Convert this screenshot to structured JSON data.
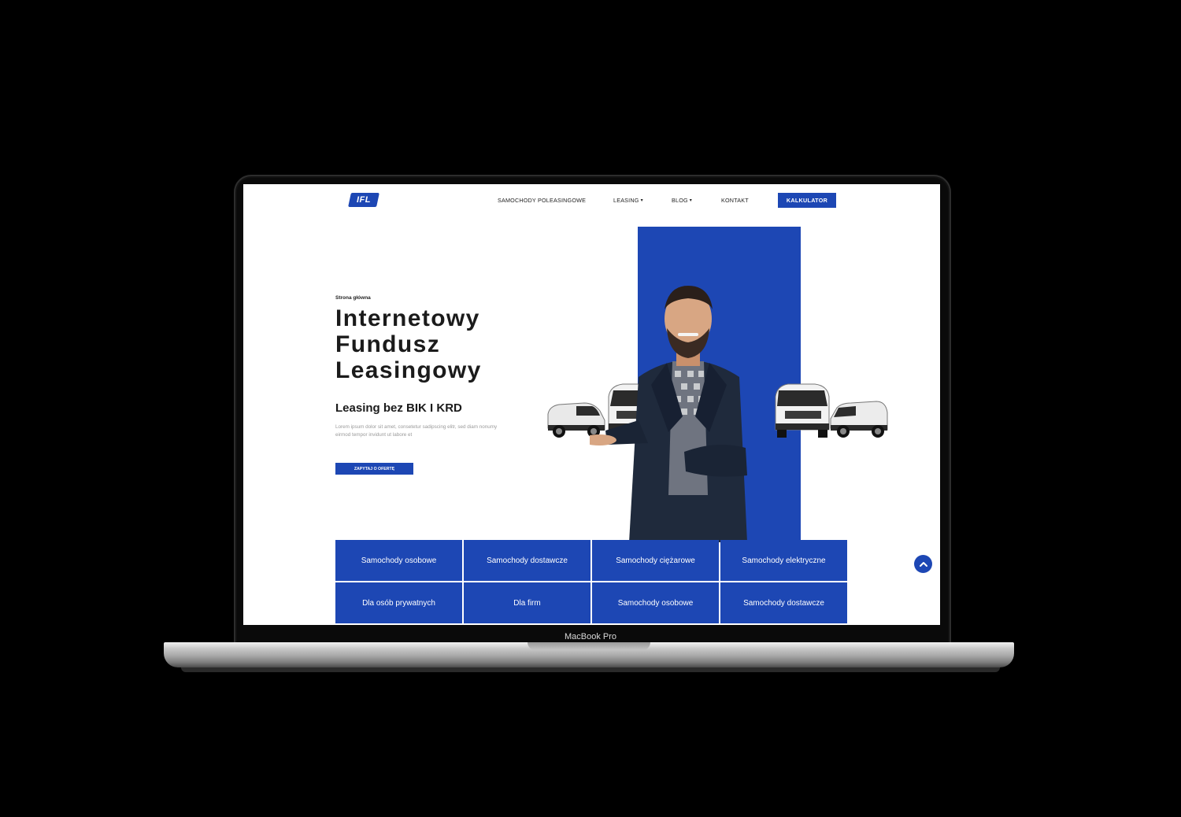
{
  "device": {
    "label": "MacBook Pro"
  },
  "site": {
    "logo_text": "IFL",
    "nav": {
      "items": [
        {
          "label": "SAMOCHODY POLEASINGOWE",
          "has_dropdown": false
        },
        {
          "label": "LEASING",
          "has_dropdown": true
        },
        {
          "label": "BLOG",
          "has_dropdown": true
        },
        {
          "label": "KONTAKT",
          "has_dropdown": false
        }
      ],
      "cta_label": "KALKULATOR"
    },
    "hero": {
      "breadcrumb": "Strona główna",
      "title": "Internetowy\nFundusz\nLeasingowy",
      "subtitle": "Leasing bez BIK I KRD",
      "text": "Lorem ipsum dolor sit amet, consetetur sadipscing elitr, sed diam nonumy eirmod tempor invidunt ut labore et",
      "button_label": "ZAPYTAJ O OFERTĘ"
    },
    "tiles": [
      "Samochody osobowe",
      "Samochody dostawcze",
      "Samochody ciężarowe",
      "Samochody elektryczne",
      "Dla osób prywatnych",
      "Dla firm",
      "Samochody osobowe",
      "Samochody dostawcze"
    ],
    "colors": {
      "brand_blue": "#1d47b4",
      "text_dark": "#1b1b1b",
      "muted": "#9a9a9a"
    },
    "icons": {
      "scroll_top": "chevron-up-icon"
    }
  }
}
